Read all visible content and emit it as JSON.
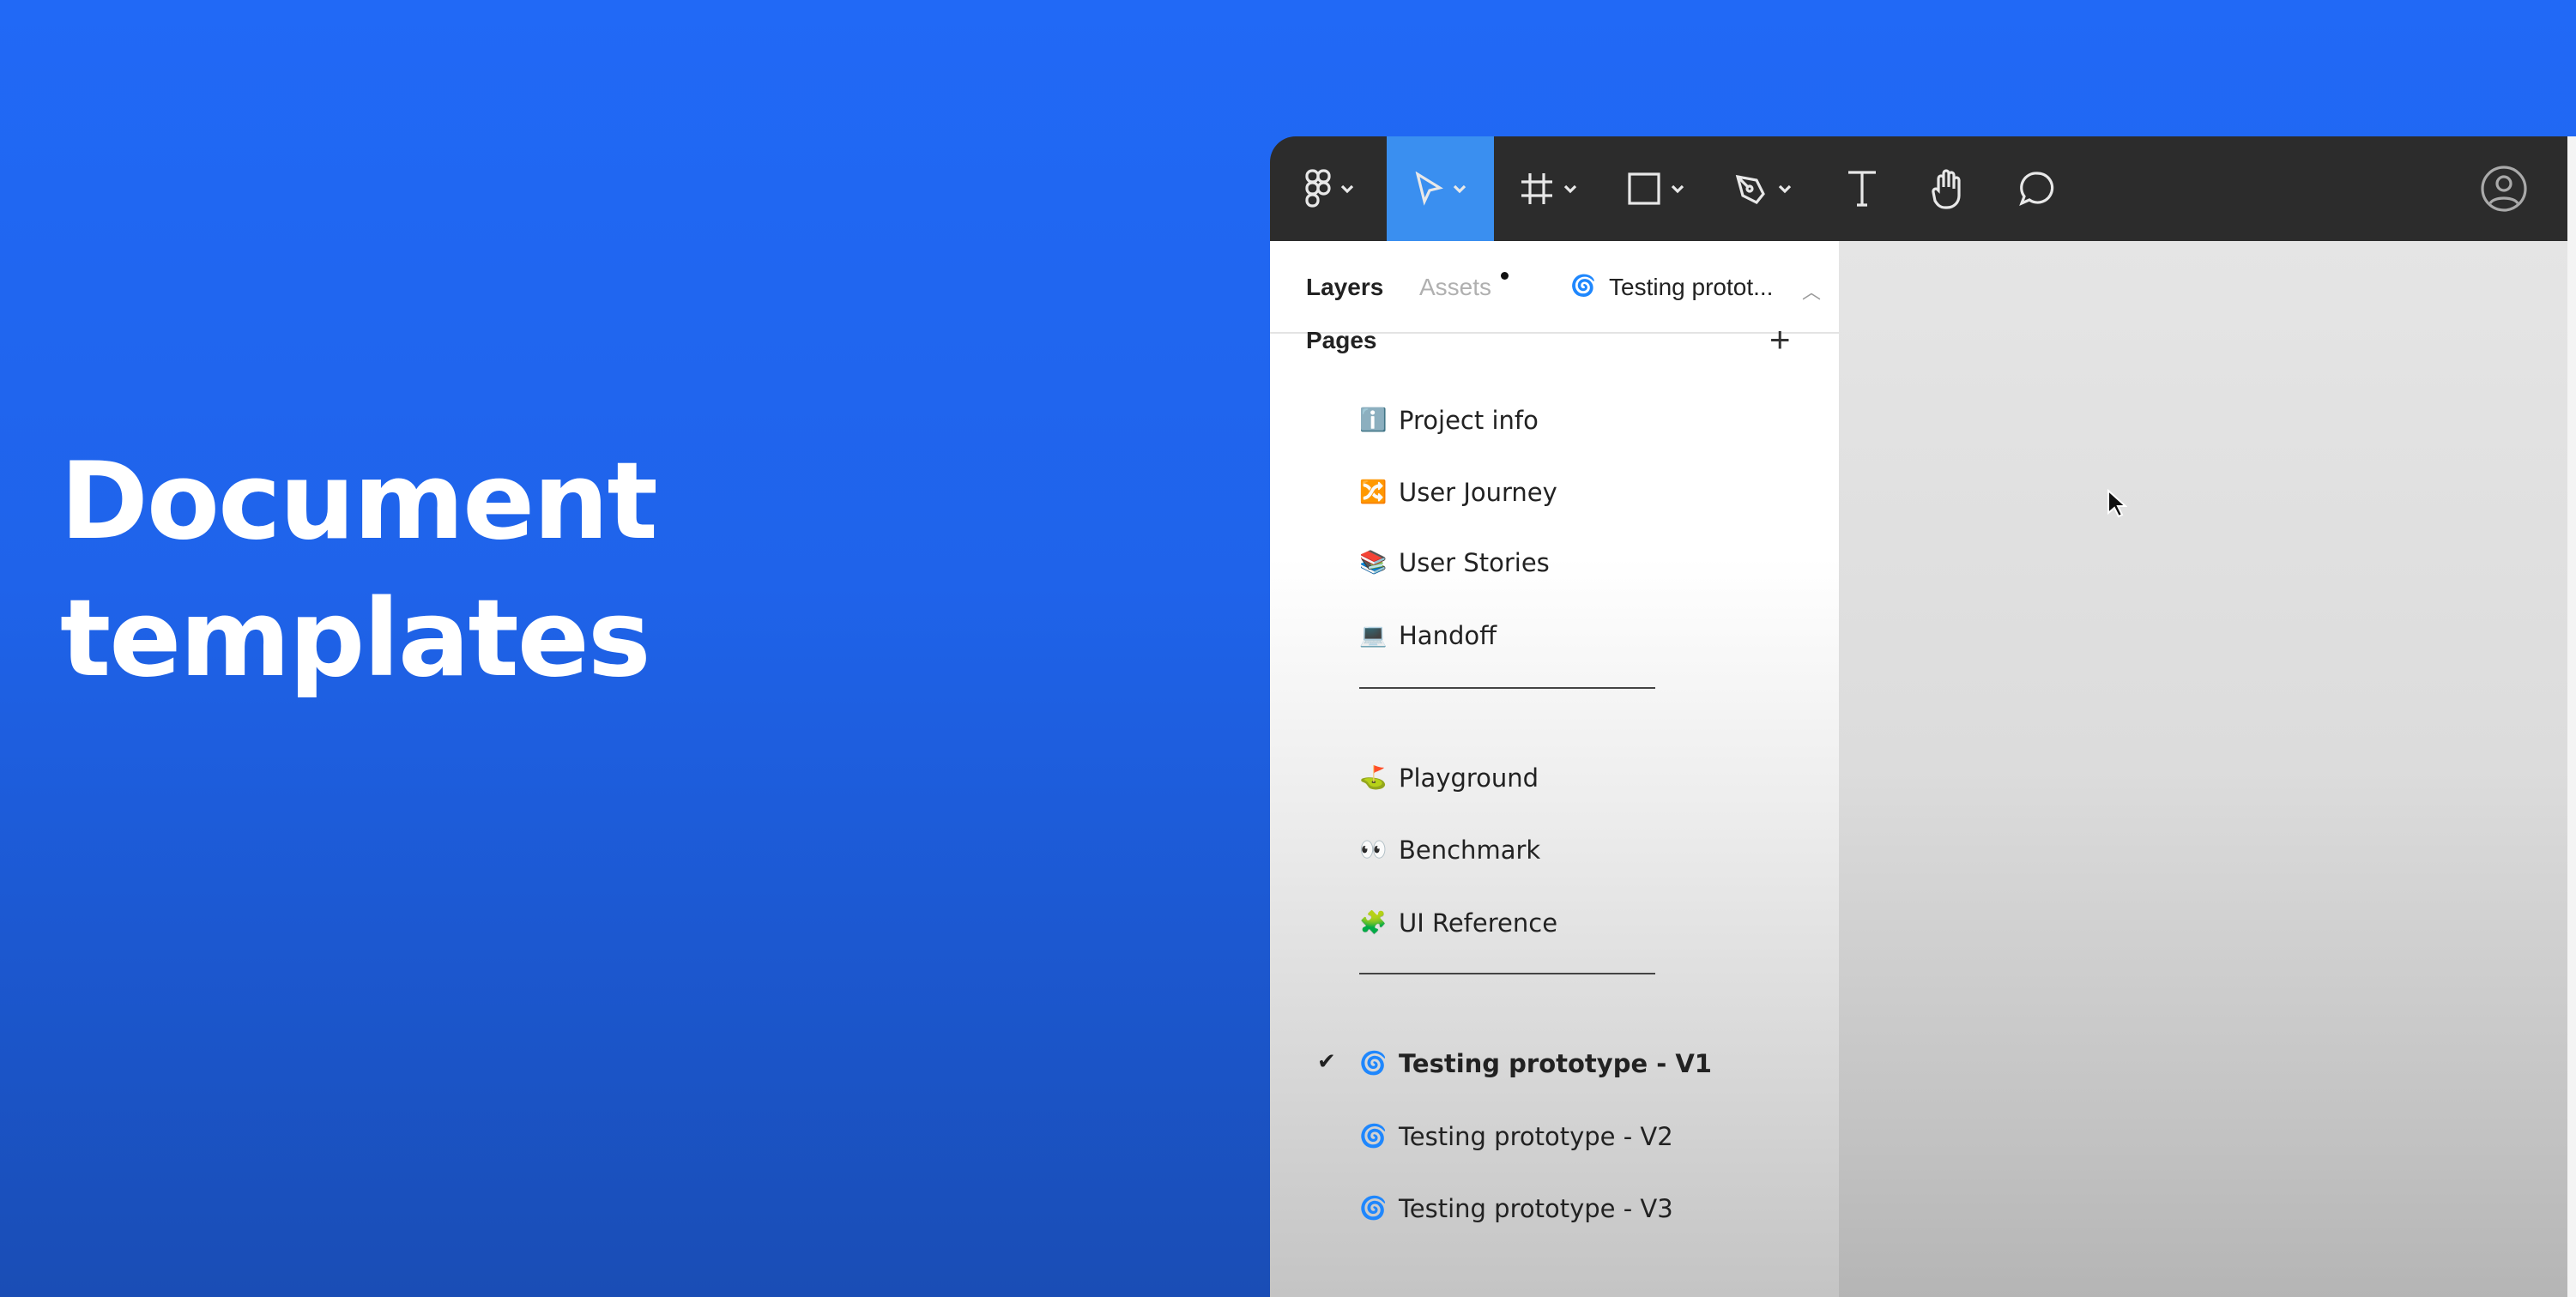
{
  "headline": {
    "line1": "Document",
    "line2": "templates"
  },
  "toolbar": {
    "tools": [
      "figma-menu",
      "move",
      "frame",
      "rectangle",
      "pen",
      "text",
      "hand",
      "comment"
    ],
    "active": "move",
    "accent": "#3a8ff0"
  },
  "sidebar": {
    "tabs": {
      "layers": "Layers",
      "assets": "Assets",
      "page_title": "Testing protot..."
    },
    "pages_label": "Pages",
    "pages": [
      {
        "icon": "ℹ️",
        "label": "Project info"
      },
      {
        "icon": "🔀",
        "label": "User Journey"
      },
      {
        "icon": "📚",
        "label": "User Stories"
      },
      {
        "icon": "💻",
        "label": "Handoff"
      },
      {
        "icon": "⛳",
        "label": "Playground"
      },
      {
        "icon": "👀",
        "label": "Benchmark"
      },
      {
        "icon": "🧩",
        "label": "UI Reference"
      },
      {
        "icon": "🌀",
        "label": "Testing prototype - V1",
        "selected": true
      },
      {
        "icon": "🌀",
        "label": "Testing prototype - V2"
      },
      {
        "icon": "🌀",
        "label": "Testing prototype - V3"
      }
    ],
    "check": "✔"
  }
}
